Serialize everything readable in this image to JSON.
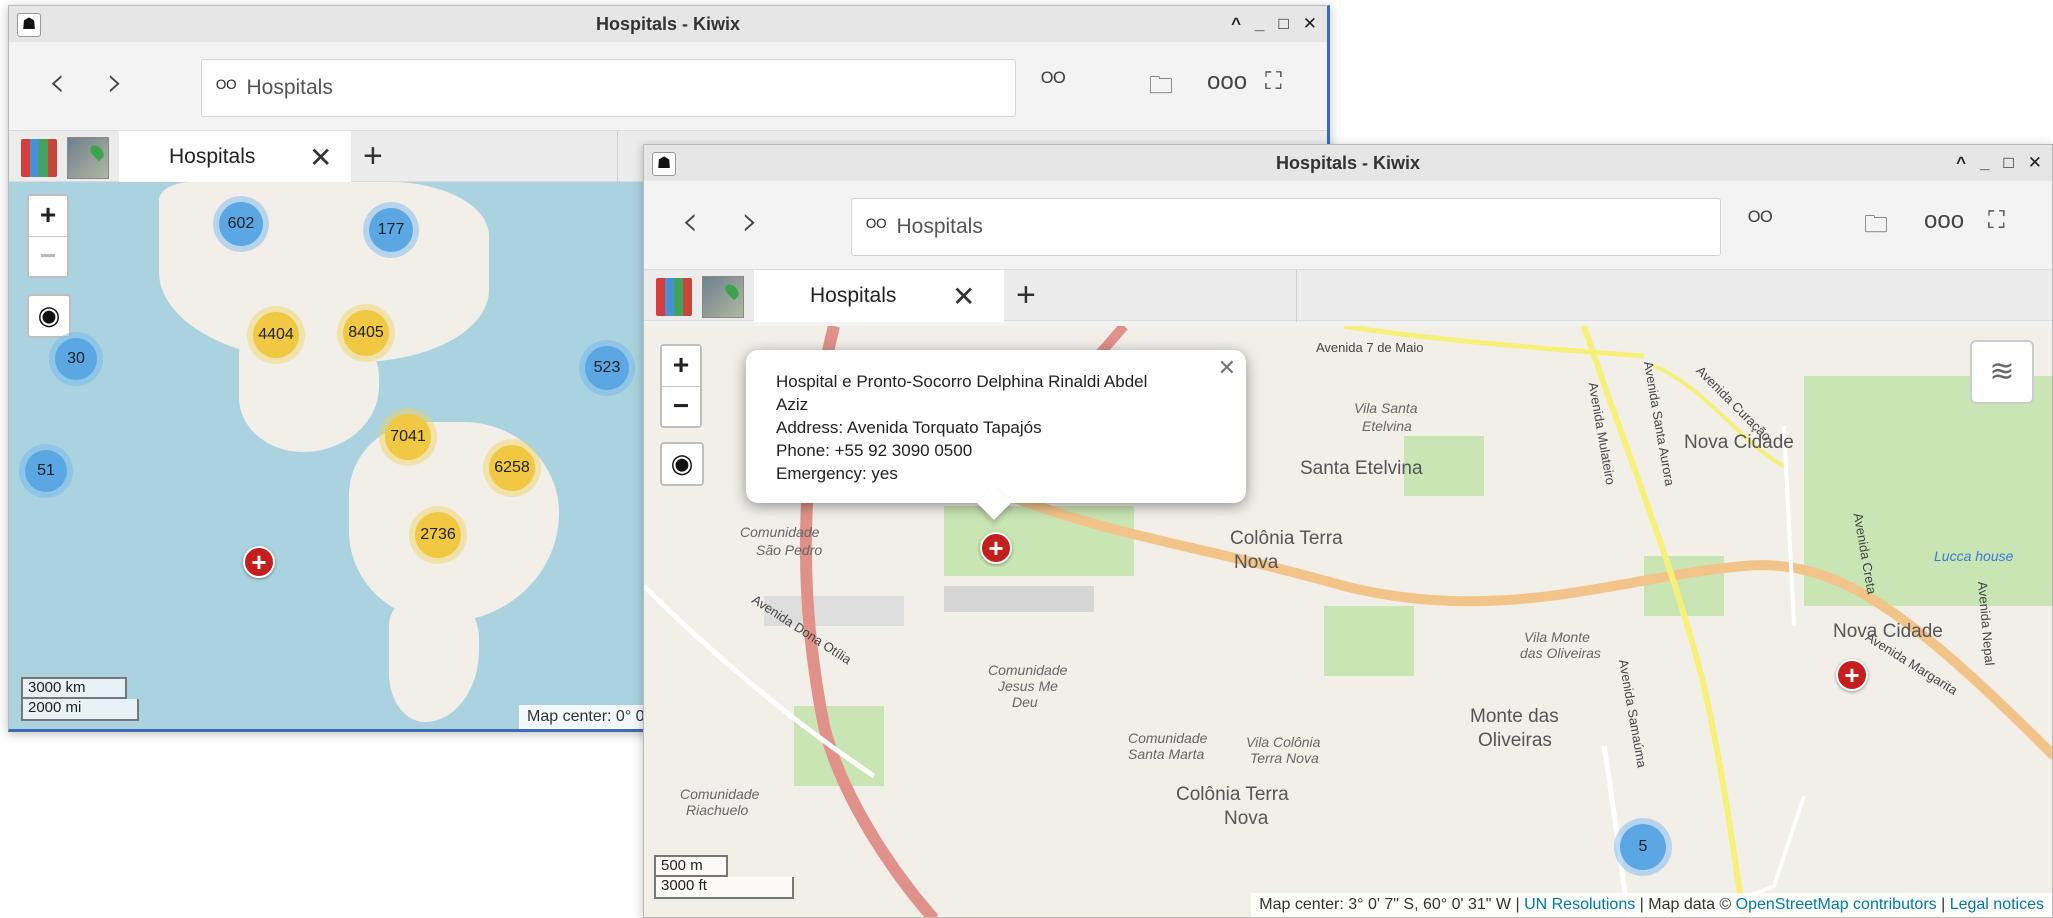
{
  "back_window": {
    "title": "Hospitals - Kiwix",
    "window_controls": [
      "^",
      "_",
      "□",
      "✕"
    ],
    "search_text": "Hospitals",
    "tab_label": "Hospitals",
    "clusters": [
      {
        "label": "602",
        "color": "blue"
      },
      {
        "label": "177",
        "color": "blue"
      },
      {
        "label": "4404",
        "color": "yellow"
      },
      {
        "label": "8405",
        "color": "yellow"
      },
      {
        "label": "30",
        "color": "blue"
      },
      {
        "label": "523",
        "color": "blue"
      },
      {
        "label": "7041",
        "color": "yellow"
      },
      {
        "label": "6258",
        "color": "yellow"
      },
      {
        "label": "51",
        "color": "blue"
      },
      {
        "label": "2736",
        "color": "yellow"
      }
    ],
    "scale_km": "3000 km",
    "scale_mi": "2000 mi",
    "attribution": "Map center: 0° 0'"
  },
  "front_window": {
    "title": "Hospitals - Kiwix",
    "window_controls": [
      "^",
      "_",
      "□",
      "✕"
    ],
    "search_text": "Hospitals",
    "tab_label": "Hospitals",
    "popup": {
      "name_line1": "Hospital e Pronto-Socorro Delphina Rinaldi Abdel",
      "name_line2": "Aziz",
      "address": "Address: Avenida Torquato Tapajós",
      "phone": "Phone: +55 92 3090 0500",
      "emergency": "Emergency: yes"
    },
    "places": [
      "Santa Etelvina",
      "Colônia Terra",
      "Nova",
      "Nova Cidade",
      "Monte das",
      "Oliveiras",
      "Colônia Terra",
      "Nova",
      "Nova Cidade"
    ],
    "small_places": [
      "Vila Santa",
      "Etelvina",
      "Comunidade",
      "São Pedro",
      "Comunidade",
      "Jesus Me",
      "Deu",
      "Vila Monte",
      "das Oliveiras",
      "Comunidade",
      "Santa Marta",
      "Vila Colônia",
      "Terra Nova",
      "Comunidade",
      "Riachuelo",
      "Lucca house"
    ],
    "streets": [
      "Avenida 7 de Maio",
      "Avenida Curação",
      "Avenida Santa Aurora",
      "Avenida Mulateiro",
      "Avenida Dona Otília",
      "Avenida Samaúma",
      "Avenida Creta",
      "Avenida Nepal",
      "Avenida Margarita"
    ],
    "cluster_label": "5",
    "scale_m": "500 m",
    "scale_ft": "3000 ft",
    "attribution": {
      "center": "Map center: 3° 0' 7\" S, 60° 0' 31\" W | ",
      "un": "UN Resolutions",
      "mapdata": " | Map data © ",
      "osm": "OpenStreetMap contributors",
      "sep": " | ",
      "legal": "Legal notices"
    }
  }
}
